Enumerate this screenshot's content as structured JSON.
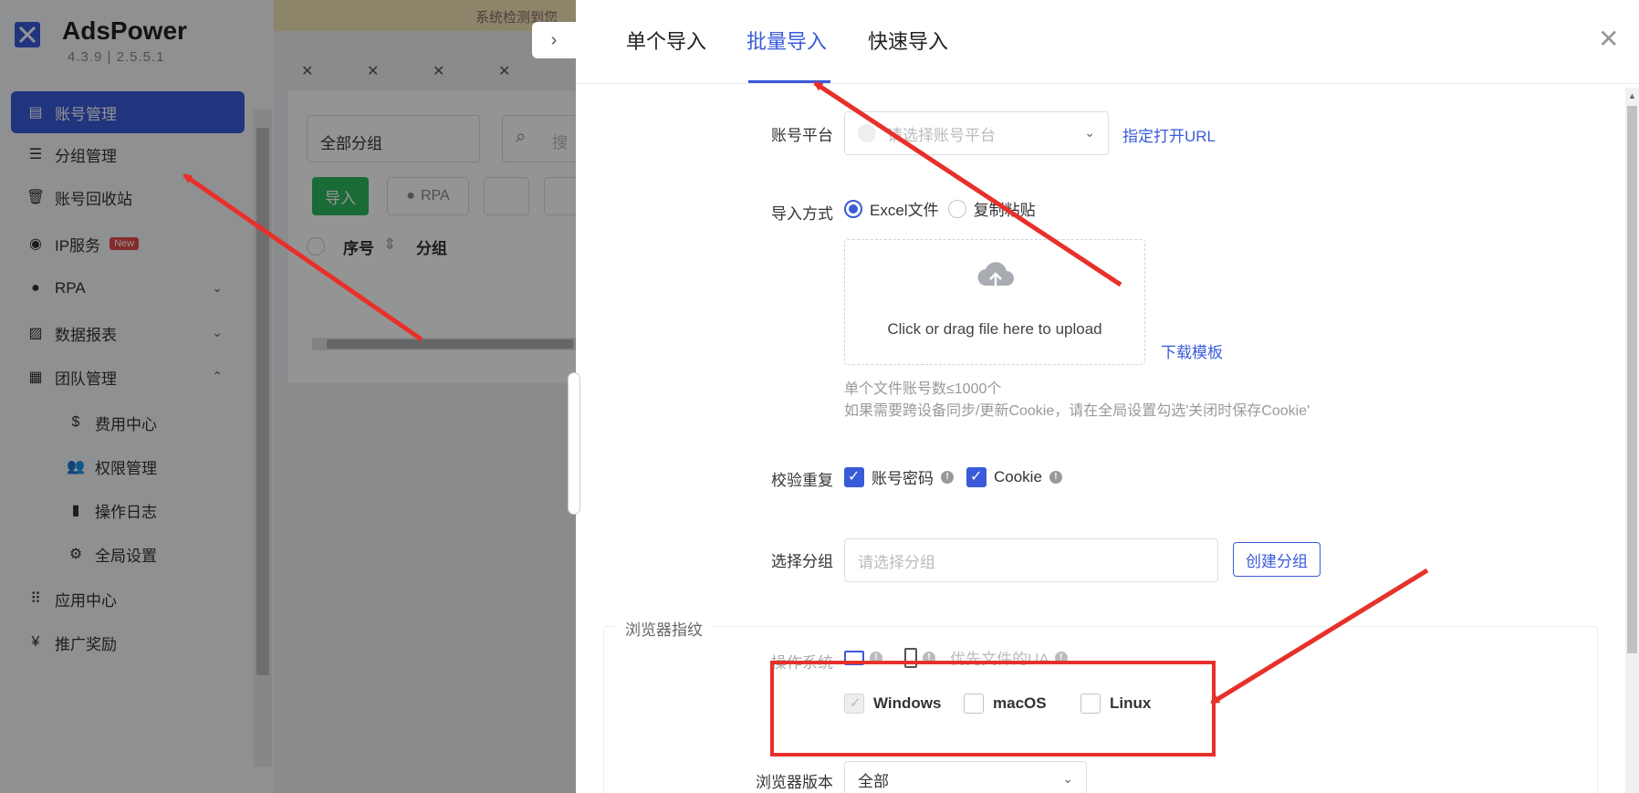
{
  "app": {
    "brand": "AdsPower",
    "version": "4.3.9  |  2.5.5.1",
    "top_banner": "系统检测到您",
    "sidebar": {
      "items": [
        {
          "label": "账号管理",
          "icon": "account-icon",
          "active": true
        },
        {
          "label": "分组管理",
          "icon": "group-icon"
        },
        {
          "label": "账号回收站",
          "icon": "trash-icon"
        },
        {
          "label": "IP服务",
          "icon": "ip-icon",
          "badge": "New"
        },
        {
          "label": "RPA",
          "icon": "robot-icon",
          "chevron": "down"
        },
        {
          "label": "数据报表",
          "icon": "chart-icon",
          "chevron": "down"
        },
        {
          "label": "团队管理",
          "icon": "team-icon",
          "chevron": "up"
        },
        {
          "label": "费用中心",
          "icon": "dollar-icon",
          "sub": true
        },
        {
          "label": "权限管理",
          "icon": "people-icon",
          "sub": true
        },
        {
          "label": "操作日志",
          "icon": "file-icon",
          "sub": true
        },
        {
          "label": "全局设置",
          "icon": "gear-icon",
          "sub": true
        },
        {
          "label": "应用中心",
          "icon": "apps-icon"
        },
        {
          "label": "推广奖励",
          "icon": "yen-icon"
        }
      ]
    },
    "content": {
      "group_select": "全部分组",
      "search_placeholder": "搜",
      "import_btn": "导入",
      "rpa_btn": "RPA",
      "col_index": "序号",
      "col_group": "分组"
    }
  },
  "drawer": {
    "tabs": [
      "单个导入",
      "批量导入",
      "快速导入"
    ],
    "active_tab": 1,
    "platform": {
      "label": "账号平台",
      "placeholder": "请选择账号平台",
      "link": "指定打开URL"
    },
    "import_method": {
      "label": "导入方式",
      "options": [
        "Excel文件",
        "复制粘贴"
      ],
      "selected": 0
    },
    "upload": {
      "text": "Click or drag file here to upload",
      "template_link": "下载模板"
    },
    "hints": [
      "单个文件账号数≤1000个",
      "如果需要跨设备同步/更新Cookie，请在全局设置勾选'关闭时保存Cookie'"
    ],
    "dedupe": {
      "label": "校验重复",
      "options": [
        {
          "label": "账号密码",
          "checked": true
        },
        {
          "label": "Cookie",
          "checked": true
        }
      ]
    },
    "group": {
      "label": "选择分组",
      "placeholder": "请选择分组",
      "create_btn": "创建分组"
    },
    "fingerprint": {
      "title": "浏览器指纹",
      "os_label": "操作系统",
      "ua_priority": "优先文件的UA",
      "os_options": [
        {
          "label": "Windows",
          "checked": true,
          "disabled": true
        },
        {
          "label": "macOS",
          "checked": false
        },
        {
          "label": "Linux",
          "checked": false
        }
      ],
      "browser_version_label": "浏览器版本",
      "browser_version_value": "全部"
    }
  },
  "colors": {
    "accent": "#3a5bd9",
    "annotation": "#e8302a",
    "green": "#2eb85c"
  }
}
